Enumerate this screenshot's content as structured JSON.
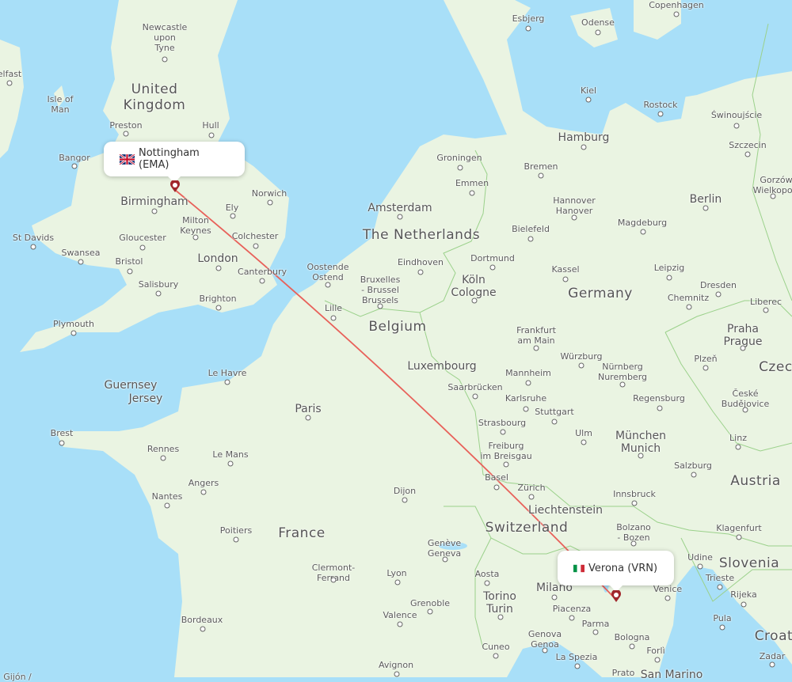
{
  "route": {
    "origin": {
      "name": "Nottingham (EMA)",
      "city": "Nottingham",
      "code": "EMA",
      "country_flag": "gb-flag"
    },
    "destination": {
      "name": "Verona (VRN)",
      "city": "Verona",
      "code": "VRN",
      "country_flag": "it-flag"
    },
    "line_color": "#e8615a",
    "marker_color": "#a0262b"
  },
  "colors": {
    "water": "#a8dff8",
    "land": "#eaf4e2",
    "border": "#9bd18b"
  },
  "countries": [
    "United Kingdom",
    "The Netherlands",
    "Belgium",
    "Germany",
    "France",
    "Switzerland",
    "Austria",
    "Czech",
    "Slovenia",
    "Croatia",
    "Luxembourg",
    "Liechtenstein",
    "San Marino"
  ],
  "places": [
    "Newcastle upon Tyne",
    "Belfast",
    "Isle of Man",
    "Preston",
    "Hull",
    "Bangor",
    "Birmingham",
    "Norwich",
    "Ely",
    "Milton Keynes",
    "St Davids",
    "Gloucester",
    "Colchester",
    "Swansea",
    "Bristol",
    "London",
    "Canterbury",
    "Salisbury",
    "Brighton",
    "Plymouth",
    "Guernsey",
    "Jersey",
    "Le Havre",
    "Paris",
    "Brest",
    "Rennes",
    "Le Mans",
    "Angers",
    "Nantes",
    "Poitiers",
    "Clermont-Ferrand",
    "Bordeaux",
    "Lyon",
    "Valence",
    "Grenoble",
    "Avignon",
    "Dijon",
    "Genève Geneva",
    "Aosta",
    "Torino Turin",
    "Cuneo",
    "Milano",
    "Piacenza",
    "Parma",
    "Genova Genoa",
    "La Spezia",
    "Bologna",
    "Forlì",
    "Prato",
    "Venice",
    "Udine",
    "Trieste",
    "Pula",
    "Rijeka",
    "Zadar",
    "Klagenfurt",
    "Bolzano - Bozen",
    "Innsbruck",
    "Salzburg",
    "Linz",
    "České Budějovice",
    "Plzeň",
    "Praha Prague",
    "Liberec",
    "Dresden",
    "Chemnitz",
    "Leipzig",
    "Berlin",
    "Magdeburg",
    "Szczecin",
    "Świnoujście",
    "Gorzów Wielkopolski",
    "Rostock",
    "Hamburg",
    "Kiel",
    "Bremen",
    "Hannover Hanover",
    "Bielefeld",
    "Kassel",
    "Dortmund",
    "Köln Cologne",
    "Frankfurt am Main",
    "Würzburg",
    "Nürnberg Nuremberg",
    "Regensburg",
    "München Munich",
    "Ulm",
    "Stuttgart",
    "Karlsruhe",
    "Mannheim",
    "Saarbrücken",
    "Strasbourg",
    "Freiburg im Breisgau",
    "Basel",
    "Zürich",
    "Groningen",
    "Emmen",
    "Amsterdam",
    "Eindhoven",
    "Bruxelles - Brussel Brussels",
    "Oostende Ostend",
    "Lille",
    "Esbjerg",
    "Odense",
    "Copenhagen",
    "Szczecin",
    "Gijón"
  ]
}
